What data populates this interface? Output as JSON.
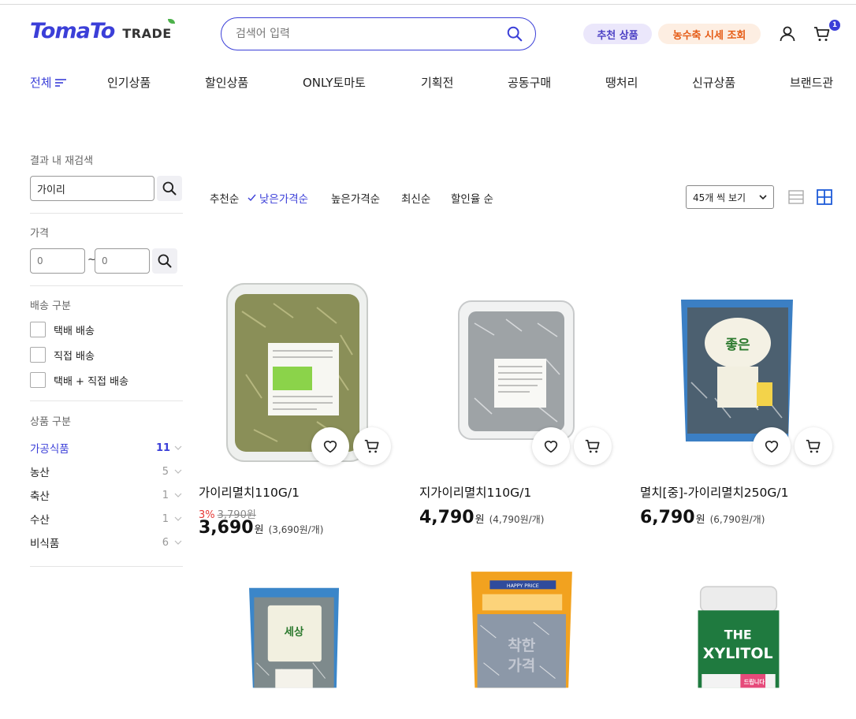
{
  "header": {
    "logo_text": "TomaTo",
    "logo_sub": "TRADE",
    "search_placeholder": "검색어 입력",
    "pill_recommend": "추천 상품",
    "pill_price": "농수축 시세 조회",
    "cart_count": "1"
  },
  "nav": {
    "all": "전체",
    "items": [
      "인기상품",
      "할인상품",
      "ONLY토마토",
      "기획전",
      "공동구매",
      "땡처리",
      "신규상품",
      "브랜드관"
    ]
  },
  "sidebar": {
    "research_title": "결과 내 재검색",
    "research_value": "가이리",
    "price_title": "가격",
    "price_min": "0",
    "price_max": "0",
    "price_sep": "~",
    "delivery_title": "배송 구분",
    "delivery_options": [
      "택배 배송",
      "직접 배송",
      "택배 + 직접 배송"
    ],
    "category_title": "상품 구분",
    "categories": [
      {
        "name": "가공식품",
        "count": "11"
      },
      {
        "name": "농산",
        "count": "5"
      },
      {
        "name": "축산",
        "count": "1"
      },
      {
        "name": "수산",
        "count": "1"
      },
      {
        "name": "비식품",
        "count": "6"
      }
    ]
  },
  "sort": {
    "options": [
      "추천순",
      "낮은가격순",
      "높은가격순",
      "최신순",
      "할인율 순"
    ],
    "active": "낮은가격순",
    "per_page": "45개 씩 보기"
  },
  "products": [
    {
      "name": "가이리멸치110G/1",
      "discount_rate": "3%",
      "original_price": "3,790원",
      "price": "3,690",
      "won": "원",
      "unit_price": "(3,690원/개)"
    },
    {
      "name": "지가이리멸치110G/1",
      "price": "4,790",
      "won": "원",
      "unit_price": "(4,790원/개)"
    },
    {
      "name": "멸치[중]-가이리멸치250G/1",
      "price": "6,790",
      "won": "원",
      "unit_price": "(6,790원/개)"
    }
  ],
  "image_text": {
    "bag_brand_a": "좋은",
    "bag_brand_b": "세상",
    "happy_price": "HAPPY PRICE",
    "cheap_a": "착한",
    "cheap_b": "가격",
    "xylitol_the": "THE",
    "xylitol_name": "XYLITOL",
    "xylitol_sub": "드립니다"
  },
  "colors": {
    "brand": "#3b3fd8",
    "discount": "#e53935",
    "price_pill_text": "#e55a14",
    "leaf": "#4cb14a"
  }
}
